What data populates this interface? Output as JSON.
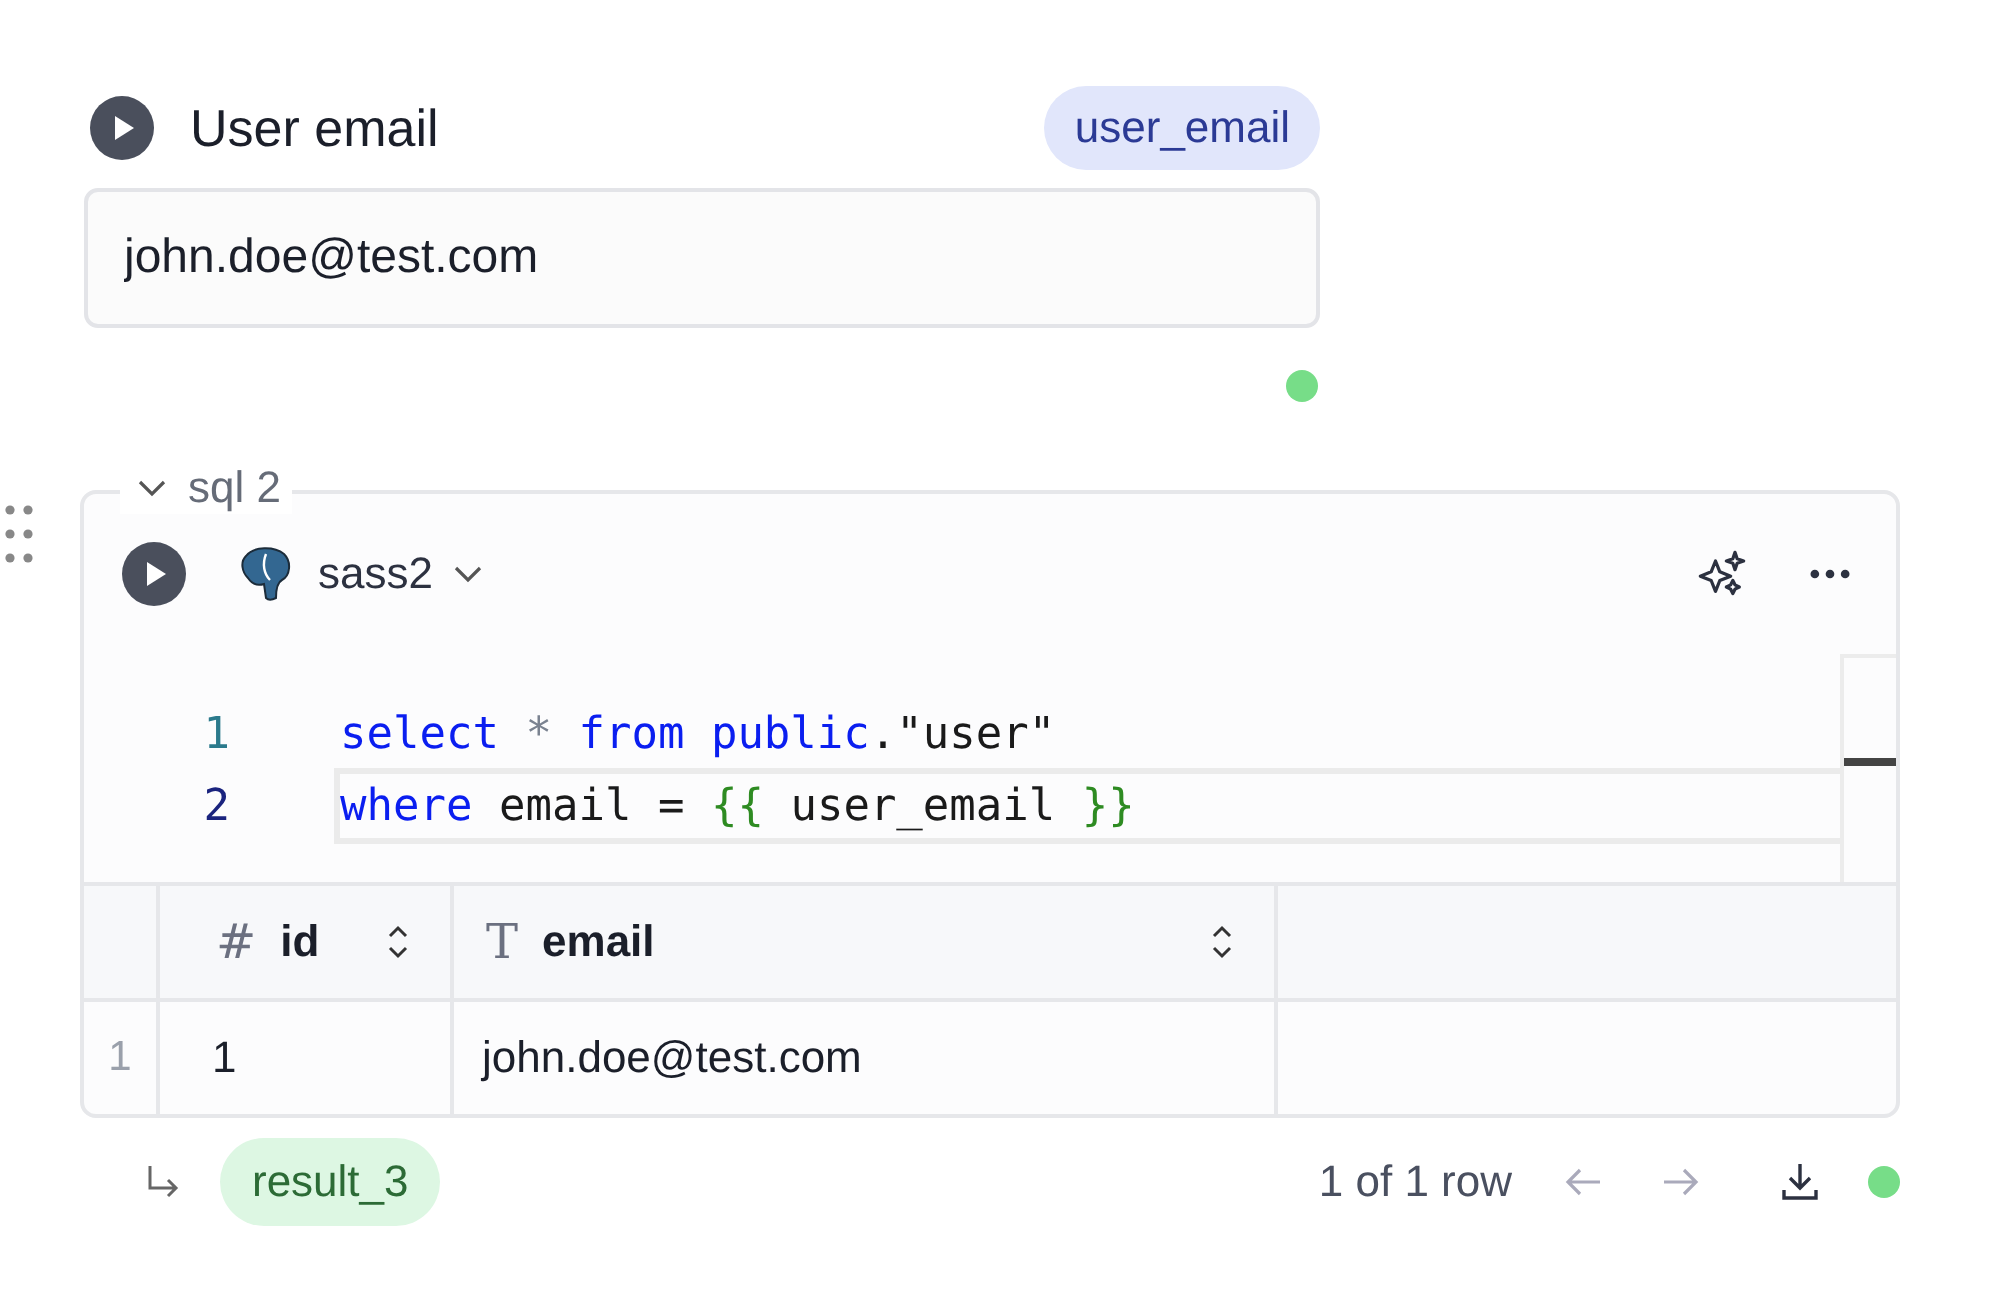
{
  "input_cell": {
    "title": "User email",
    "variable": "user_email",
    "value": "john.doe@test.com",
    "succeeded": true
  },
  "sql_cell": {
    "label": "sql 2",
    "connection": "sass2",
    "code": [
      {
        "number": "1",
        "active": false,
        "tokens": [
          {
            "kind": "keyword",
            "text": "select "
          },
          {
            "kind": "op",
            "text": "* "
          },
          {
            "kind": "keyword",
            "text": "from public"
          },
          {
            "kind": "plain",
            "text": ".\"user\""
          }
        ]
      },
      {
        "number": "2",
        "active": true,
        "tokens": [
          {
            "kind": "keyword",
            "text": "where "
          },
          {
            "kind": "plain",
            "text": "email = "
          },
          {
            "kind": "brace",
            "text": "{{ "
          },
          {
            "kind": "plain",
            "text": "user_email "
          },
          {
            "kind": "brace",
            "text": "}}"
          }
        ]
      }
    ],
    "table": {
      "columns": [
        {
          "type": "#",
          "name": "id"
        },
        {
          "type": "T",
          "name": "email"
        }
      ],
      "rows": [
        {
          "index": "1",
          "cells": [
            "1",
            "john.doe@test.com"
          ]
        }
      ]
    },
    "result_name": "result_3",
    "row_count": "1 of 1 row",
    "succeeded": true
  }
}
